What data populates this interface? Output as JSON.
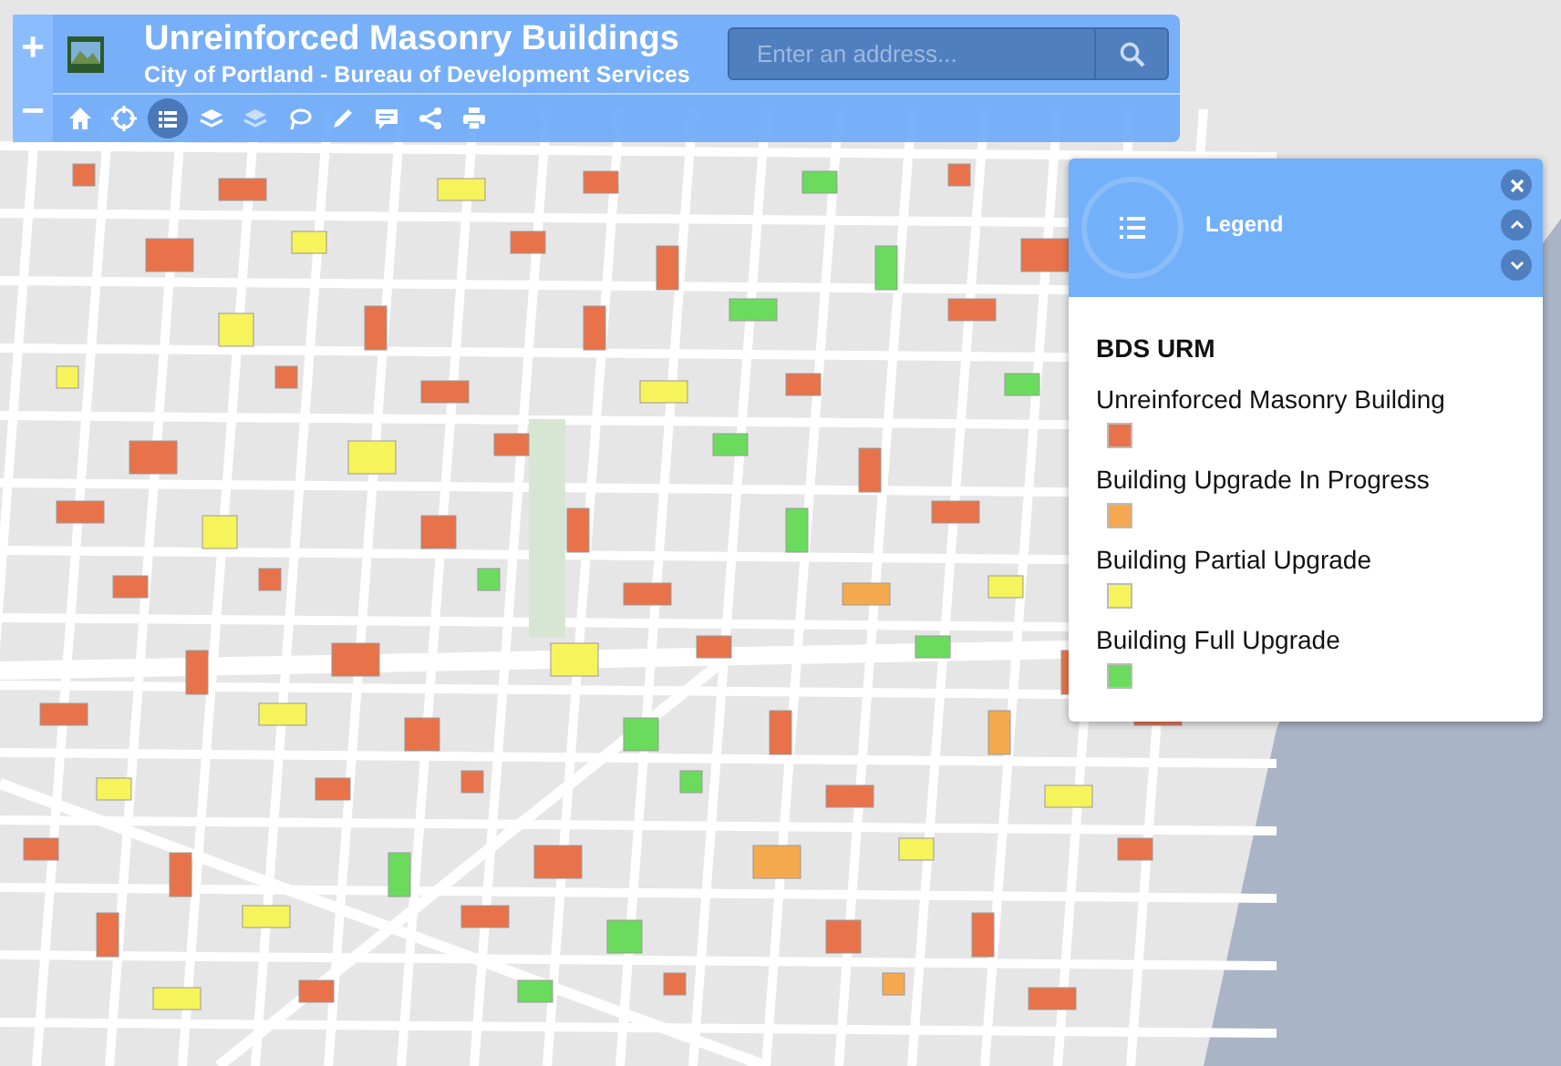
{
  "app": {
    "title": "Unreinforced Masonry Buildings",
    "subtitle": "City of Portland - Bureau of Development Services"
  },
  "zoom_controls": [
    "+",
    "−"
  ],
  "search": {
    "placeholder": "Enter an address..."
  },
  "tools": [
    {
      "kind": "home",
      "selected": false
    },
    {
      "kind": "locate",
      "selected": false
    },
    {
      "kind": "legend",
      "selected": true
    },
    {
      "kind": "layers",
      "selected": false
    },
    {
      "kind": "basemap",
      "selected": false
    },
    {
      "kind": "select",
      "selected": false
    },
    {
      "kind": "measure",
      "selected": false
    },
    {
      "kind": "comment",
      "selected": false
    },
    {
      "kind": "share",
      "selected": false
    },
    {
      "kind": "print",
      "selected": false
    }
  ],
  "legend_panel": {
    "title": "Legend",
    "layer": "BDS URM",
    "items": [
      {
        "label": "Unreinforced Masonry Building",
        "color": "#e8734a"
      },
      {
        "label": "Building Upgrade In Progress",
        "color": "#f5a94e"
      },
      {
        "label": "Building Partial Upgrade",
        "color": "#f7f35a"
      },
      {
        "label": "Building Full Upgrade",
        "color": "#6bdb5e"
      }
    ]
  }
}
